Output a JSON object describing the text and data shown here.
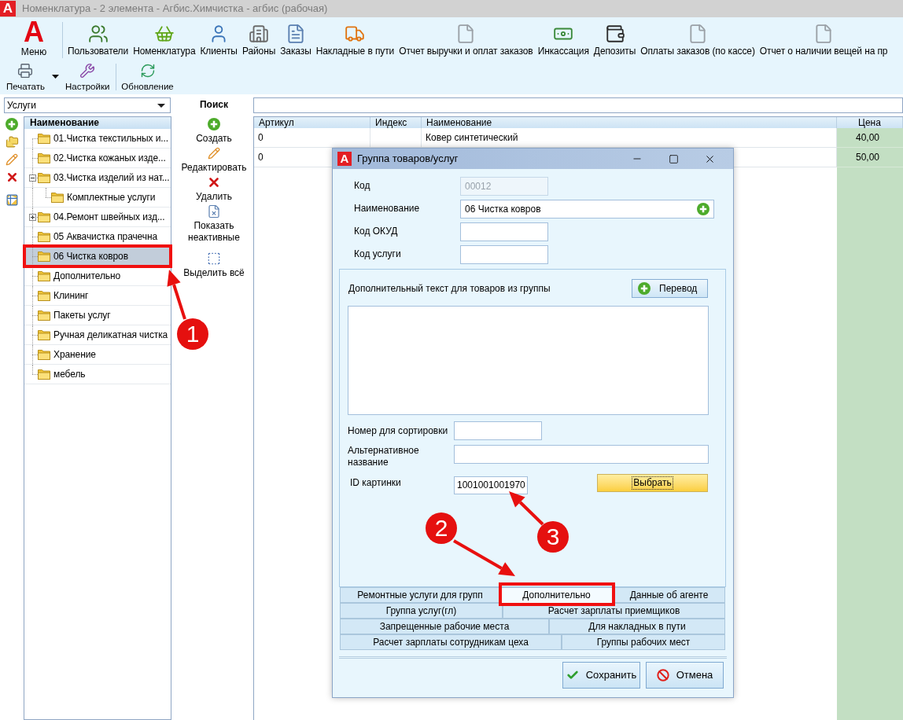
{
  "window": {
    "logo": "A",
    "title": "Номенклатура - 2 элемента - Агбис.Химчистка - агбис (рабочая)"
  },
  "ribbon": {
    "menu_button": {
      "logo": "A",
      "label": "Меню"
    },
    "main_buttons": [
      "Пользователи",
      "Номенклатура",
      "Клиенты",
      "Районы",
      "Заказы",
      "Накладные в пути",
      "Отчет выручки и оплат заказов",
      "Инкассация",
      "Депозиты",
      "Оплаты заказов (по кассе)",
      "Отчет о наличии вещей на пр"
    ],
    "secondary_buttons": [
      {
        "label": "Печатать",
        "has_menu": true
      },
      {
        "label": "Настройки",
        "has_menu": false
      },
      {
        "label": "Обновление",
        "has_menu": false
      }
    ]
  },
  "category_select": {
    "value": "Услуги"
  },
  "tree": {
    "header": "Наименование",
    "items": [
      {
        "label": "01.Чистка текстильных и...",
        "selected": false
      },
      {
        "label": "02.Чистка кожаных изде...",
        "selected": false
      },
      {
        "label": "03.Чистка изделий из нат...",
        "selected": false,
        "expanded": true,
        "children": [
          {
            "label": "Комплектные услуги",
            "selected": false
          }
        ]
      },
      {
        "label": "04.Ремонт швейных изд...",
        "selected": false,
        "expanded": false
      },
      {
        "label": "05 Аквачистка прачечна",
        "selected": false
      },
      {
        "label": "06 Чистка ковров",
        "selected": true
      },
      {
        "label": "Дополнительно",
        "selected": false
      },
      {
        "label": "Клининг",
        "selected": false
      },
      {
        "label": "Пакеты услуг",
        "selected": false
      },
      {
        "label": "Ручная деликатная чистка",
        "selected": false
      },
      {
        "label": "Хранение",
        "selected": false
      },
      {
        "label": "мебель",
        "selected": false
      }
    ]
  },
  "actions": {
    "title": "Поиск",
    "items": [
      "Создать",
      "Редактировать",
      "Удалить",
      "Показать неактивные",
      "Выделить всё"
    ]
  },
  "table": {
    "columns": [
      "Артикул",
      "Индекс",
      "Наименование",
      "Цена"
    ],
    "rows": [
      {
        "article": "0",
        "name": "Ковер синтетический",
        "price": "40,00"
      },
      {
        "article": "0",
        "price": "50,00"
      }
    ]
  },
  "dialog": {
    "logo": "A",
    "title": "Группа товаров/услуг",
    "fields": [
      {
        "label": "Код",
        "value": "00012",
        "disabled": true
      },
      {
        "label": "Наименование",
        "value": "06 Чистка ковров",
        "disabled": false
      },
      {
        "label": "Код ОКУД",
        "disabled": false
      },
      {
        "label": "Код услуги",
        "disabled": false
      }
    ],
    "extra_text": {
      "label": "Дополнительный текст для товаров из группы",
      "button": "Перевод"
    },
    "extra_fields": [
      {
        "label": "Номер для сортировки"
      },
      {
        "label": "Альтернативное название"
      },
      {
        "label": "ID картинки",
        "value": "1001001001970"
      }
    ],
    "choose_button": "Выбрать",
    "tab_rows": [
      [
        {
          "label": "Ремонтные услуги для групп",
          "selected": false
        },
        {
          "label": "Дополнительно",
          "selected": true
        },
        {
          "label": "Данные об агенте",
          "selected": false
        }
      ],
      [
        {
          "label": "Группа услуг(гл)",
          "selected": false
        },
        {
          "label": "Расчет зарплаты приемщиков",
          "selected": false
        }
      ],
      [
        {
          "label": "Запрещенные рабочие места",
          "selected": false
        },
        {
          "label": "Для накладных в пути",
          "selected": false
        }
      ],
      [
        {
          "label": "Расчет зарплаты сотрудникам цеха",
          "selected": false
        },
        {
          "label": "Группы рабочих мест",
          "selected": false
        }
      ]
    ],
    "buttons": [
      {
        "label": "Сохранить",
        "kind": "save"
      },
      {
        "label": "Отмена",
        "kind": "cancel"
      }
    ]
  },
  "annotations": [
    {
      "number": "1"
    },
    {
      "number": "2"
    },
    {
      "number": "3"
    }
  ]
}
